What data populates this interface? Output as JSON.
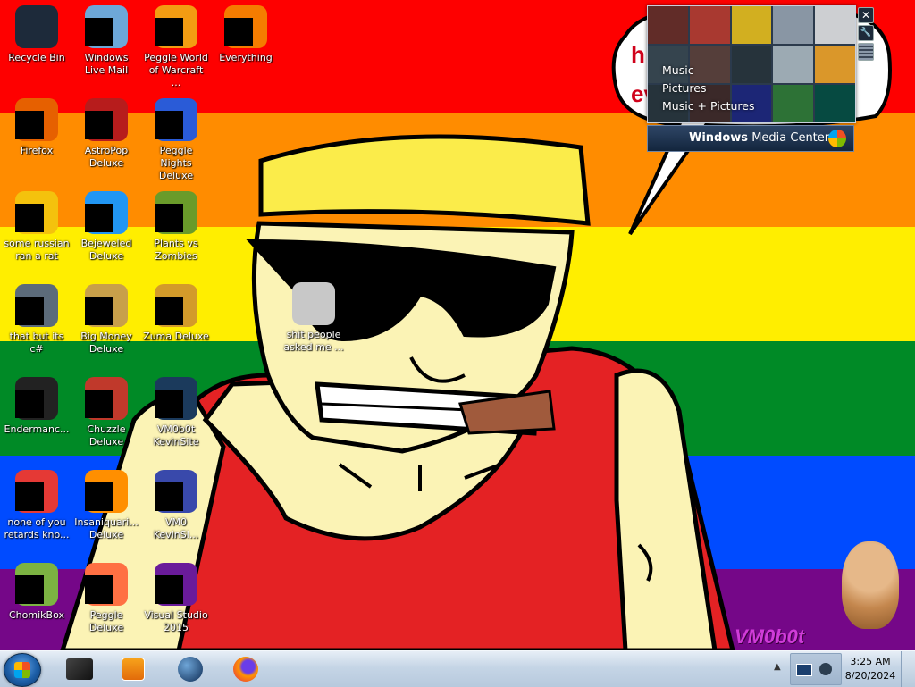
{
  "colors": {
    "stripes": [
      "#fe0000",
      "#ff8c00",
      "#ffee00",
      "#008a26",
      "#004bff",
      "#750788"
    ],
    "skin": "#fbf3b5",
    "bandana": "#fbec4a",
    "shirt": "#e42224",
    "cigar": "#a05a3c",
    "taskbar": "#c5d5e6"
  },
  "desktop": {
    "icons": [
      {
        "label": "Recycle Bin",
        "icon": "recycle-bin-icon"
      },
      {
        "label": "Windows Live Mail",
        "icon": "mail-icon"
      },
      {
        "label": "Peggle World of Warcraft ...",
        "icon": "peggle-icon"
      },
      {
        "label": "Everything",
        "icon": "search-icon"
      },
      {
        "label": "Firefox",
        "icon": "firefox-icon"
      },
      {
        "label": "AstroPop Deluxe",
        "icon": "game-icon"
      },
      {
        "label": "Peggle Nights Deluxe",
        "icon": "peggle-icon"
      },
      {
        "label": "some russian ran a rat",
        "icon": "media-icon"
      },
      {
        "label": "Bejeweled Deluxe",
        "icon": "gem-icon"
      },
      {
        "label": "Plants vs Zombies",
        "icon": "plant-icon"
      },
      {
        "label": "that but its c#",
        "icon": "app-icon"
      },
      {
        "label": "Big Money Deluxe",
        "icon": "money-bag-icon"
      },
      {
        "label": "Zuma Deluxe",
        "icon": "zuma-icon"
      },
      {
        "label": "Endermanc...",
        "icon": "terminal-icon"
      },
      {
        "label": "Chuzzle Deluxe",
        "icon": "chuzzle-icon"
      },
      {
        "label": "VM0b0t KevinSite",
        "icon": "monitor-icon"
      },
      {
        "label": "none of you retards kno...",
        "icon": "chrome-icon"
      },
      {
        "label": "Insaniquari... Deluxe",
        "icon": "fish-icon"
      },
      {
        "label": "VM0 KevinSi...",
        "icon": "document-icon"
      },
      {
        "label": "ChomikBox",
        "icon": "hamster-icon"
      },
      {
        "label": "Peggle Deluxe",
        "icon": "peggle-icon"
      },
      {
        "label": "Visual Studio 2015",
        "icon": "visual-studio-icon"
      },
      {
        "label": "shit people asked me ...",
        "icon": "folder-icon"
      }
    ]
  },
  "gadget": {
    "speech_text": [
      "h",
      "ev"
    ],
    "menu": [
      "Music",
      "Pictures",
      "Music + Pictures"
    ],
    "bar_title_bold": "Windows",
    "bar_title_rest": "Media Center",
    "close_glyph": "✕",
    "tools_glyph": "🔧"
  },
  "watermark": "VM0b0t",
  "taskbar": {
    "pinned": [
      {
        "name": "wmc-app-icon"
      },
      {
        "name": "media-player-icon"
      },
      {
        "name": "globe-icon"
      },
      {
        "name": "firefox-icon"
      }
    ],
    "tray_arrow": "▲",
    "time": "3:25 AM",
    "date": "8/20/2024"
  }
}
